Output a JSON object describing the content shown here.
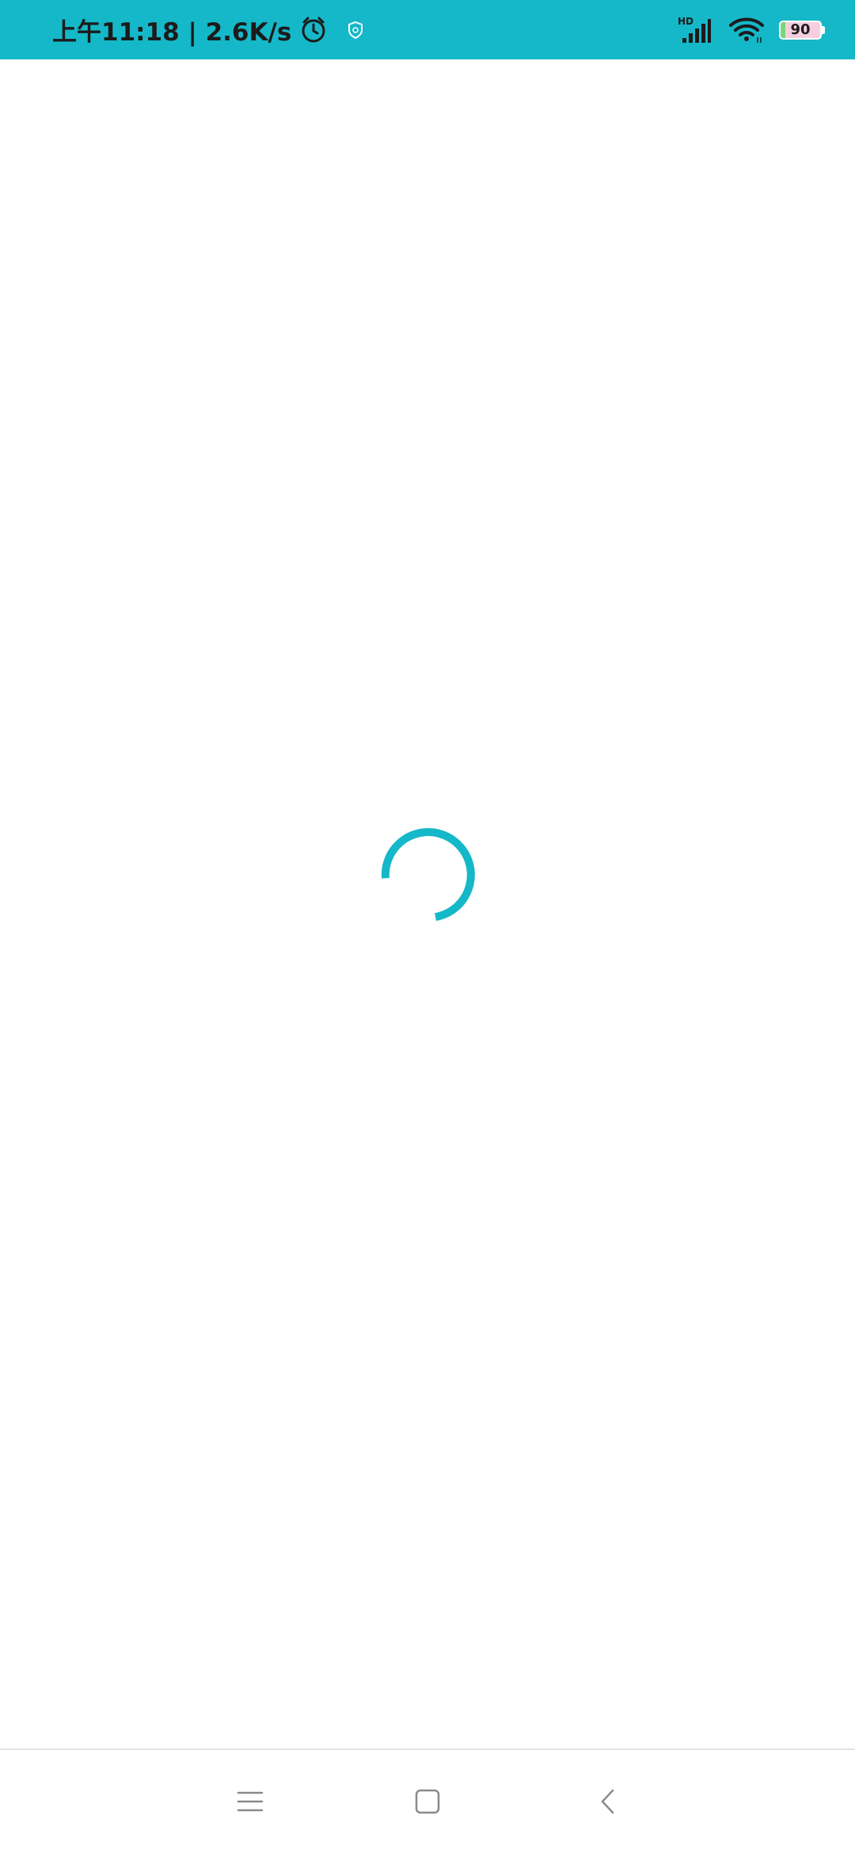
{
  "status_bar": {
    "time": "上午11:18",
    "separator": "|",
    "network_speed": "2.6K/s",
    "status_text": "上午11:18 | 2.6K/s",
    "signal_label": "HD",
    "battery_level": "90",
    "background_color": "#15B8C8"
  },
  "content": {
    "loading_indicator_color": "#15B8C8"
  },
  "nav_bar": {
    "icons": [
      "menu-icon",
      "home-icon",
      "back-icon"
    ]
  }
}
